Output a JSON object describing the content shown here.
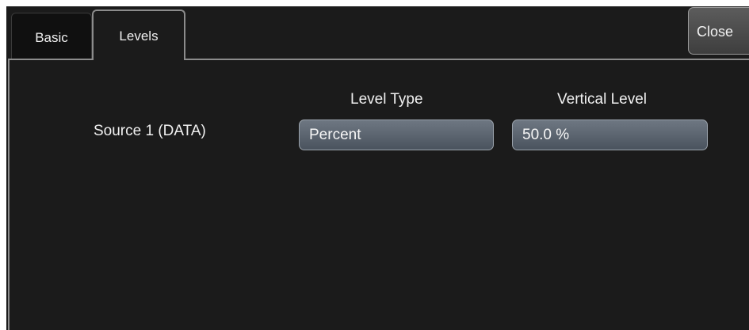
{
  "tabs": [
    {
      "label": "Basic",
      "active": false
    },
    {
      "label": "Levels",
      "active": true
    }
  ],
  "close_label": "Close",
  "source": {
    "label": "Source 1 (DATA)"
  },
  "level_type": {
    "header": "Level Type",
    "value": "Percent"
  },
  "vertical_level": {
    "header": "Vertical Level",
    "value": "50.0 %"
  },
  "colors": {
    "background": "#1b1b1b",
    "field_top": "#6e7782",
    "field_bottom": "#4a535e",
    "text": "#f0f0f0"
  }
}
